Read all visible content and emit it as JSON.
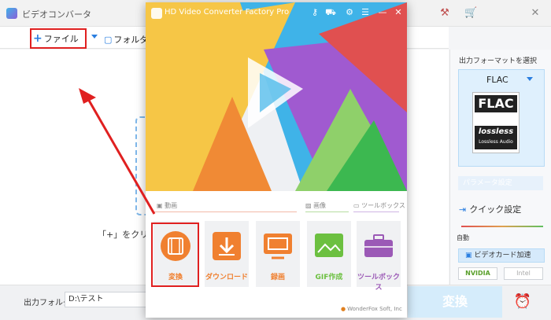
{
  "background_window": {
    "title": "ビデオコンバータ",
    "toolbar": {
      "add_file_label": "ファイル追加",
      "add_folder_label": "フォルダ追"
    },
    "drop_hint": "「+」をクリックし",
    "output_folder_label": "出力フォルダ：",
    "output_folder_value": "D:\\テスト",
    "convert_label": "変換",
    "right_panel": {
      "title": "出力フォーマットを選択",
      "format_name": "FLAC",
      "flac_logo_top": "FLAC",
      "flac_logo_word": "lossless",
      "flac_logo_sub": "Lossless Audio",
      "param_label": "パラメータ設定",
      "quick_setting_label": "クイック設定",
      "auto_label": "自動",
      "gpu_label": "ビデオカード加速",
      "nvidia_label": "NVIDIA",
      "intel_label": "Intel"
    }
  },
  "launcher": {
    "title": "HD Video Converter Factory Pro",
    "sections": {
      "video": "動画",
      "image": "画像",
      "toolbox": "ツールボックス"
    },
    "tiles": [
      {
        "label": "変換",
        "color": "#f08030"
      },
      {
        "label": "ダウンロード",
        "color": "#f08030"
      },
      {
        "label": "録画",
        "color": "#f08030"
      },
      {
        "label": "GIF作成",
        "color": "#6cc040"
      },
      {
        "label": "ツールボックス",
        "color": "#9b59b6"
      }
    ],
    "footer": "WonderFox Soft, Inc"
  },
  "colors": {
    "highlight_red": "#e02020",
    "accent_blue": "#2a7ee0"
  }
}
